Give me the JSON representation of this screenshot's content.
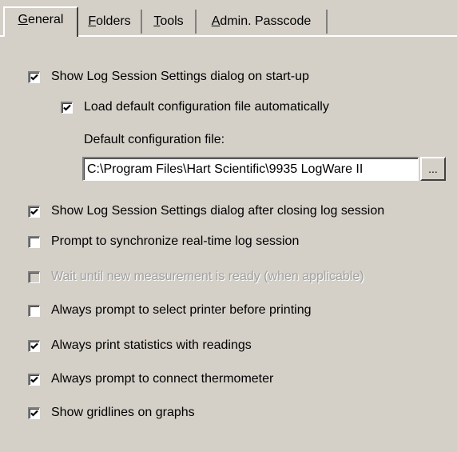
{
  "tabs": [
    {
      "label": "General",
      "active": true
    },
    {
      "label": "Folders",
      "active": false
    },
    {
      "label": "Tools",
      "active": false
    },
    {
      "label": "Admin. Passcode",
      "active": false
    }
  ],
  "options": {
    "show_settings_startup": {
      "label": "Show Log Session Settings dialog on start-up",
      "checked": true,
      "enabled": true
    },
    "load_default_config": {
      "label": "Load default configuration file automatically",
      "checked": true,
      "enabled": true
    },
    "show_settings_after_close": {
      "label": "Show Log Session Settings dialog after closing log session",
      "checked": true,
      "enabled": true
    },
    "prompt_sync": {
      "label": "Prompt to synchronize real-time log session",
      "checked": false,
      "enabled": true
    },
    "wait_measurement": {
      "label": "Wait until new measurement is ready (when applicable)",
      "checked": false,
      "enabled": false
    },
    "prompt_printer": {
      "label": "Always prompt to select printer before printing",
      "checked": false,
      "enabled": true
    },
    "print_statistics": {
      "label": "Always print statistics with readings",
      "checked": true,
      "enabled": true
    },
    "prompt_thermometer": {
      "label": "Always prompt to connect thermometer",
      "checked": true,
      "enabled": true
    },
    "show_gridlines": {
      "label": "Show gridlines on graphs",
      "checked": true,
      "enabled": true
    }
  },
  "default_config": {
    "label": "Default configuration file:",
    "value": "C:\\Program Files\\Hart Scientific\\9935 LogWare II",
    "browse_label": "..."
  }
}
